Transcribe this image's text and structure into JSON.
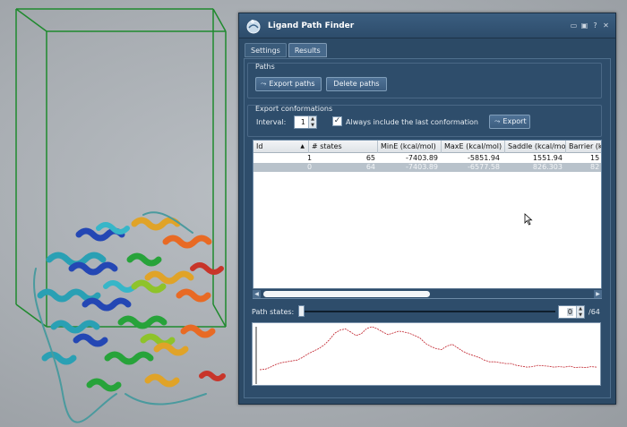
{
  "window": {
    "title": "Ligand Path Finder",
    "controls": [
      "minimize-icon",
      "lock-icon",
      "help-icon",
      "close-icon"
    ]
  },
  "tabs": [
    {
      "label": "Settings",
      "active": false
    },
    {
      "label": "Results",
      "active": true
    }
  ],
  "paths_group": {
    "title": "Paths",
    "export_label": "Export paths",
    "delete_label": "Delete paths"
  },
  "export_group": {
    "title": "Export conformations",
    "interval_label": "Interval:",
    "interval_value": "1",
    "always_include_label": "Always include the last conformation",
    "always_include_checked": true,
    "export_label": "Export"
  },
  "table": {
    "columns": [
      "Id",
      "# states",
      "MinE (kcal/mol)",
      "MaxE (kcal/mol)",
      "Saddle (kcal/mo",
      "Barrier (k"
    ],
    "sort_indicator": "▲",
    "rows": [
      [
        "1",
        "65",
        "-7403.89",
        "-5851.94",
        "1551.94",
        "15"
      ],
      [
        "0",
        "64",
        "-7403.89",
        "-6577.58",
        "826.303",
        "82"
      ]
    ],
    "selected_row": 1
  },
  "path_states": {
    "label": "Path states:",
    "value": "0",
    "total": "/64",
    "fraction": 0.0
  },
  "energy_plot": {
    "color": "#c0202a",
    "values": [
      2,
      3,
      8,
      14,
      18,
      20,
      22,
      24,
      30,
      38,
      44,
      50,
      58,
      70,
      85,
      92,
      95,
      88,
      80,
      84,
      96,
      100,
      95,
      88,
      82,
      86,
      90,
      88,
      85,
      80,
      74,
      62,
      55,
      50,
      48,
      56,
      60,
      52,
      44,
      38,
      34,
      30,
      24,
      20,
      20,
      18,
      16,
      16,
      12,
      10,
      8,
      9,
      12,
      11,
      10,
      8,
      9,
      8,
      10,
      7,
      8,
      7,
      9,
      8
    ]
  },
  "colors": {
    "window_bg": "#2c4a66",
    "box_edge": "#1f8a2e",
    "accent_red": "#c0202a"
  }
}
